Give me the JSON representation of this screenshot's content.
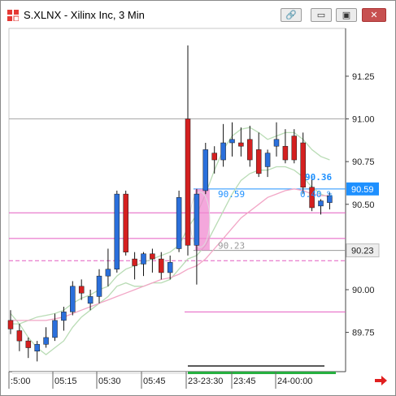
{
  "window": {
    "title": "S.XLNX - Xilinx Inc, 3 Min",
    "buttons": {
      "link": "🔗",
      "minimize": "▭",
      "maximize": "▣",
      "close": "✕"
    }
  },
  "colors": {
    "up_candle": "#2a6fdb",
    "down_candle": "#d42020",
    "band_outer": "#b9dcb5",
    "band_inner": "#f2a6c6",
    "level_line": "#e45bc0",
    "price_tag_bg": "#1e90ff"
  },
  "chart_data": {
    "type": "candlestick",
    "y_axis": {
      "ticks": [
        89.75,
        90.0,
        90.25,
        90.5,
        90.75,
        91.0,
        91.25
      ],
      "tick_labels": [
        "89.75",
        "90.00",
        "90.25",
        "90.50",
        "90.75",
        "91.00",
        "91.25"
      ],
      "ylim": [
        89.52,
        91.53
      ]
    },
    "x_axis": {
      "tick_labels": [
        ":5:00",
        "05:15",
        "05:30",
        "05:45",
        "23-23:30",
        "23:45",
        "24-00:00"
      ]
    },
    "candles": [
      {
        "o": 89.82,
        "h": 89.88,
        "l": 89.74,
        "c": 89.77
      },
      {
        "o": 89.76,
        "h": 89.8,
        "l": 89.64,
        "c": 89.7
      },
      {
        "o": 89.7,
        "h": 89.72,
        "l": 89.6,
        "c": 89.66
      },
      {
        "o": 89.64,
        "h": 89.7,
        "l": 89.58,
        "c": 89.68
      },
      {
        "o": 89.68,
        "h": 89.78,
        "l": 89.66,
        "c": 89.72
      },
      {
        "o": 89.72,
        "h": 89.86,
        "l": 89.7,
        "c": 89.82
      },
      {
        "o": 89.82,
        "h": 89.9,
        "l": 89.76,
        "c": 89.87
      },
      {
        "o": 89.87,
        "h": 90.05,
        "l": 89.85,
        "c": 90.02
      },
      {
        "o": 90.02,
        "h": 90.06,
        "l": 89.94,
        "c": 89.98
      },
      {
        "o": 89.92,
        "h": 90.0,
        "l": 89.88,
        "c": 89.96
      },
      {
        "o": 89.96,
        "h": 90.12,
        "l": 89.92,
        "c": 90.08
      },
      {
        "o": 90.08,
        "h": 90.24,
        "l": 90.02,
        "c": 90.12
      },
      {
        "o": 90.12,
        "h": 90.58,
        "l": 90.1,
        "c": 90.56
      },
      {
        "o": 90.56,
        "h": 90.58,
        "l": 90.2,
        "c": 90.22
      },
      {
        "o": 90.18,
        "h": 90.22,
        "l": 90.06,
        "c": 90.14
      },
      {
        "o": 90.15,
        "h": 90.22,
        "l": 90.08,
        "c": 90.21
      },
      {
        "o": 90.21,
        "h": 90.24,
        "l": 90.1,
        "c": 90.18
      },
      {
        "o": 90.18,
        "h": 90.22,
        "l": 90.06,
        "c": 90.1
      },
      {
        "o": 90.1,
        "h": 90.2,
        "l": 90.06,
        "c": 90.16
      },
      {
        "o": 90.24,
        "h": 90.58,
        "l": 90.22,
        "c": 90.54
      },
      {
        "o": 91.0,
        "h": 91.43,
        "l": 90.2,
        "c": 90.26
      },
      {
        "o": 90.26,
        "h": 90.59,
        "l": 90.03,
        "c": 90.56
      },
      {
        "o": 90.58,
        "h": 90.86,
        "l": 90.56,
        "c": 90.82
      },
      {
        "o": 90.8,
        "h": 90.84,
        "l": 90.68,
        "c": 90.76
      },
      {
        "o": 90.76,
        "h": 90.97,
        "l": 90.72,
        "c": 90.86
      },
      {
        "o": 90.86,
        "h": 90.98,
        "l": 90.78,
        "c": 90.88
      },
      {
        "o": 90.86,
        "h": 90.95,
        "l": 90.78,
        "c": 90.84
      },
      {
        "o": 90.88,
        "h": 90.96,
        "l": 90.72,
        "c": 90.76
      },
      {
        "o": 90.82,
        "h": 90.92,
        "l": 90.66,
        "c": 90.68
      },
      {
        "o": 90.72,
        "h": 90.82,
        "l": 90.66,
        "c": 90.8
      },
      {
        "o": 90.84,
        "h": 90.98,
        "l": 90.78,
        "c": 90.88
      },
      {
        "o": 90.84,
        "h": 90.94,
        "l": 90.74,
        "c": 90.76
      },
      {
        "o": 90.9,
        "h": 90.94,
        "l": 90.74,
        "c": 90.76
      },
      {
        "o": 90.86,
        "h": 90.92,
        "l": 90.56,
        "c": 90.6
      },
      {
        "o": 90.6,
        "h": 90.66,
        "l": 90.46,
        "c": 90.48
      },
      {
        "o": 90.49,
        "h": 90.53,
        "l": 90.44,
        "c": 90.52
      },
      {
        "o": 90.51,
        "h": 90.57,
        "l": 90.47,
        "c": 90.55
      }
    ],
    "band_upper": [
      89.8,
      89.8,
      89.82,
      89.84,
      89.85,
      89.86,
      89.88,
      89.92,
      89.95,
      89.97,
      90.0,
      90.02,
      90.08,
      90.12,
      90.14,
      90.16,
      90.18,
      90.2,
      90.22,
      90.26,
      90.36,
      90.44,
      90.56,
      90.7,
      90.82,
      90.9,
      90.94,
      90.95,
      90.92,
      90.88,
      90.9,
      90.92,
      90.92,
      90.88,
      90.82,
      90.78,
      90.76
    ],
    "band_lower": [
      89.86,
      89.8,
      89.72,
      89.66,
      89.62,
      89.66,
      89.7,
      89.78,
      89.84,
      89.88,
      89.92,
      89.96,
      90.02,
      90.04,
      90.02,
      90.02,
      90.04,
      90.04,
      90.06,
      90.12,
      90.18,
      90.2,
      90.26,
      90.36,
      90.46,
      90.56,
      90.64,
      90.68,
      90.7,
      90.7,
      90.72,
      90.72,
      90.7,
      90.66,
      90.6,
      90.56,
      90.54
    ],
    "band_mid": [
      89.82,
      89.82,
      89.82,
      89.82,
      89.82,
      89.83,
      89.84,
      89.86,
      89.88,
      89.9,
      89.92,
      89.94,
      89.96,
      89.98,
      90.0,
      90.02,
      90.04,
      90.06,
      90.07,
      90.09,
      90.12,
      90.14,
      90.18,
      90.24,
      90.3,
      90.36,
      90.42,
      90.46,
      90.5,
      90.54,
      90.56,
      90.58,
      90.59,
      90.58,
      90.56,
      90.55,
      90.55
    ],
    "levels": [
      {
        "value": 91.0,
        "color": "#a8a8a8",
        "start": 0
      },
      {
        "value": 90.59,
        "color": "#1e90ff",
        "start": 21
      },
      {
        "value": 90.45,
        "color": "#e45bc0",
        "start": 0
      },
      {
        "value": 90.3,
        "color": "#e45bc0",
        "start": 0
      },
      {
        "value": 90.23,
        "color": "#9a9a9a",
        "start": 21
      },
      {
        "value": 90.17,
        "color": "#e45bc0",
        "start": 0,
        "dashed": true
      },
      {
        "value": 89.87,
        "color": "#e45bc0",
        "start": 20
      }
    ],
    "current_price": "90.59",
    "marker_price": "90.23",
    "marker_price_label": "90.23",
    "highlight_label": "90.59",
    "change_price": "90.36",
    "change_pct": "0.40 %"
  }
}
